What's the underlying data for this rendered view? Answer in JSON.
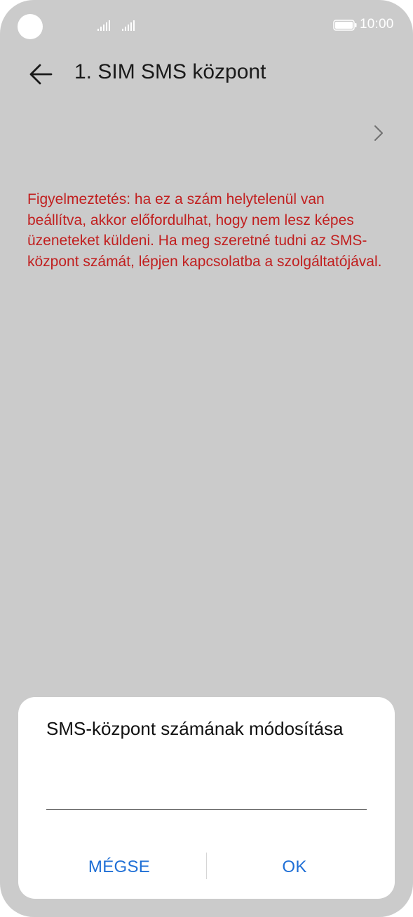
{
  "status_bar": {
    "time": "10:00",
    "icons": [
      "camera-hole",
      "signal-icon",
      "signal-icon",
      "battery-icon"
    ]
  },
  "header": {
    "back_icon": "arrow-left-icon",
    "title": "1. SIM SMS központ"
  },
  "content": {
    "row_icon": "chevron-right-icon",
    "warning": "Figyelmeztetés: ha ez a szám helytelenül van beállítva, akkor előfordulhat, hogy nem lesz képes üzeneteket küldeni. Ha meg szeretné tudni az SMS-központ számát, lépjen kapcsolatba a szolgáltatójával.",
    "warning_color": "#c11f1f"
  },
  "dialog": {
    "title": "SMS-központ számának módosítása",
    "input_value": "",
    "cancel_label": "MÉGSE",
    "ok_label": "OK",
    "accent_color": "#1f6fd6"
  },
  "colors": {
    "background": "#cbcbcb",
    "dialog_background": "#ffffff"
  }
}
